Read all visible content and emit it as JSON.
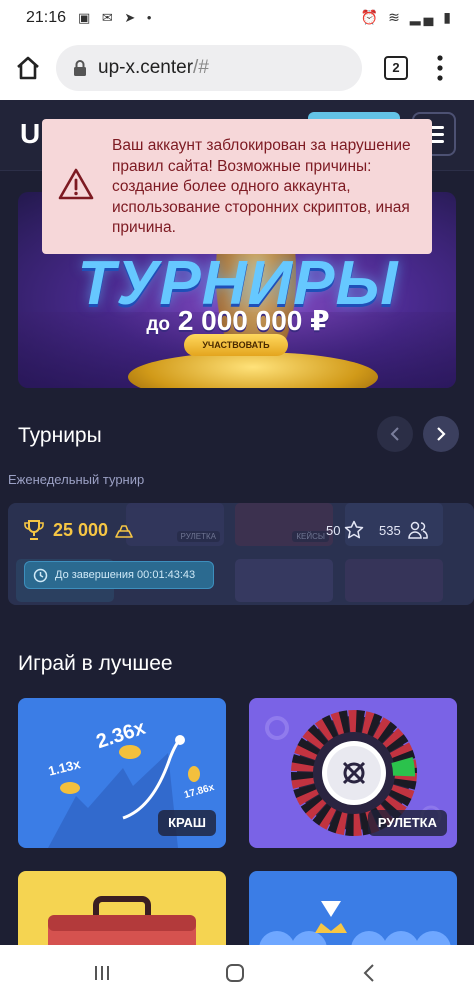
{
  "status_bar": {
    "time": "21:16",
    "left_icons": "▣ ✉ ➤ •",
    "right_icons": "⏰ ≋ ▂▄ ▮"
  },
  "browser": {
    "url_host": "up-x.center",
    "url_fragment": "/#",
    "tab_count": "2"
  },
  "site": {
    "logo": "U"
  },
  "alert": {
    "message": "Ваш аккаунт заблокирован за нарушение правил сайта! Возможные причины: создание более одного аккаунта, использование сторонних скриптов, иная причина."
  },
  "banner": {
    "title": "ТУРНИРЫ",
    "subtitle_prefix": "до",
    "subtitle_amount": "2 000 000 ₽",
    "button": "УЧАСТВОВАТЬ"
  },
  "tournaments": {
    "title": "Турниры",
    "card_label": "Еженедельный турнир",
    "prize": "25 000",
    "stars": "50",
    "players": "535",
    "timer": "До завершения 00:01:43:43",
    "thumbs": [
      "РУЛЕТКА",
      "КЕЙСЫ"
    ]
  },
  "games": {
    "title": "Играй в лучшее",
    "crash": {
      "label": "КРАШ",
      "mult_main": "2.36x",
      "mult_left": "1.13x",
      "mult_right": "17.86x"
    },
    "roulette": {
      "label": "РУЛЕТКА"
    }
  },
  "colors": {
    "page_bg": "#1d1f33",
    "alert_bg": "#f6d7d9",
    "alert_text": "#7d1a22",
    "prize_gold": "#f6c644",
    "crash_blue": "#3b7de6",
    "roulette_purple": "#7a63e6",
    "case_yellow": "#f5d451"
  }
}
